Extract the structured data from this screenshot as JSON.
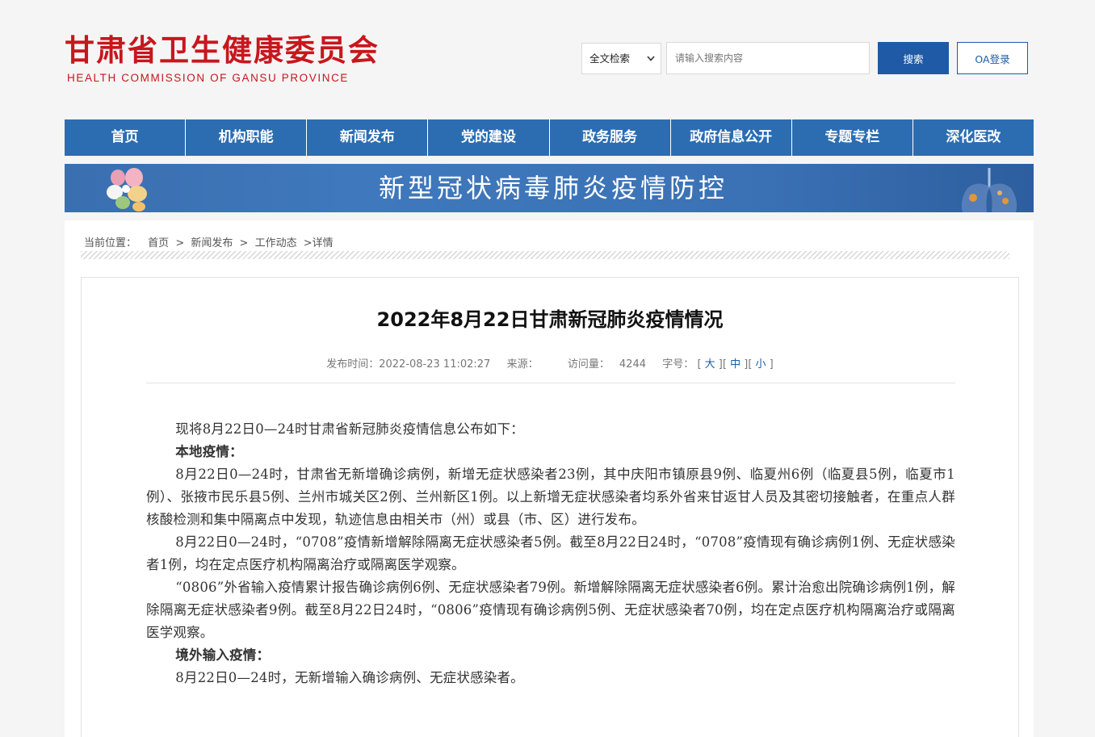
{
  "header": {
    "logo_cn": "甘肃省卫生健康委员会",
    "logo_en": "HEALTH  COMMISSION  OF  GANSU PROVINCE",
    "search_scope": "全文检索",
    "search_placeholder": "请输入搜索内容",
    "search_button": "搜索",
    "oa_button": "OA登录"
  },
  "nav": {
    "items": [
      "首页",
      "机构职能",
      "新闻发布",
      "党的建设",
      "政务服务",
      "政府信息公开",
      "专题专栏",
      "深化医改"
    ]
  },
  "banner": {
    "text": "新型冠状病毒肺炎疫情防控"
  },
  "breadcrumb": {
    "label": "当前位置：",
    "items": [
      "首页",
      "新闻发布",
      "工作动态",
      "详情"
    ],
    "separator": ">"
  },
  "article": {
    "title": "2022年8月22日甘肃新冠肺炎疫情情况",
    "publish_label": "发布时间：",
    "publish_time": "2022-08-23 11:02:27",
    "source_label": "来源：",
    "views_label": "访问量：",
    "views": "4244",
    "fontsize_label": "字号：",
    "fontsize_options": [
      "大",
      "中",
      "小"
    ],
    "paragraphs": [
      {
        "text": "现将8月22日0—24时甘肃省新冠肺炎疫情信息公布如下：",
        "bold": false
      },
      {
        "text": "本地疫情：",
        "bold": true
      },
      {
        "text": "8月22日0—24时，甘肃省无新增确诊病例，新增无症状感染者23例，其中庆阳市镇原县9例、临夏州6例（临夏县5例，临夏市1例）、张掖市民乐县5例、兰州市城关区2例、兰州新区1例。以上新增无症状感染者均系外省来甘返甘人员及其密切接触者，在重点人群核酸检测和集中隔离点中发现，轨迹信息由相关市（州）或县（市、区）进行发布。",
        "bold": false
      },
      {
        "text": "8月22日0—24时，“0708”疫情新增解除隔离无症状感染者5例。截至8月22日24时，“0708”疫情现有确诊病例1例、无症状感染者1例，均在定点医疗机构隔离治疗或隔离医学观察。",
        "bold": false
      },
      {
        "text": "“0806”外省输入疫情累计报告确诊病例6例、无症状感染者79例。新增解除隔离无症状感染者6例。累计治愈出院确诊病例1例，解除隔离无症状感染者9例。截至8月22日24时，“0806”疫情现有确诊病例5例、无症状感染者70例，均在定点医疗机构隔离治疗或隔离医学观察。",
        "bold": false
      },
      {
        "text": "境外输入疫情：",
        "bold": true
      },
      {
        "text": "8月22日0—24时，无新增输入确诊病例、无症状感染者。",
        "bold": false
      }
    ]
  },
  "colors": {
    "brand_red": "#c8161d",
    "nav_blue": "#2c6db2",
    "button_blue": "#1f5aa6"
  }
}
